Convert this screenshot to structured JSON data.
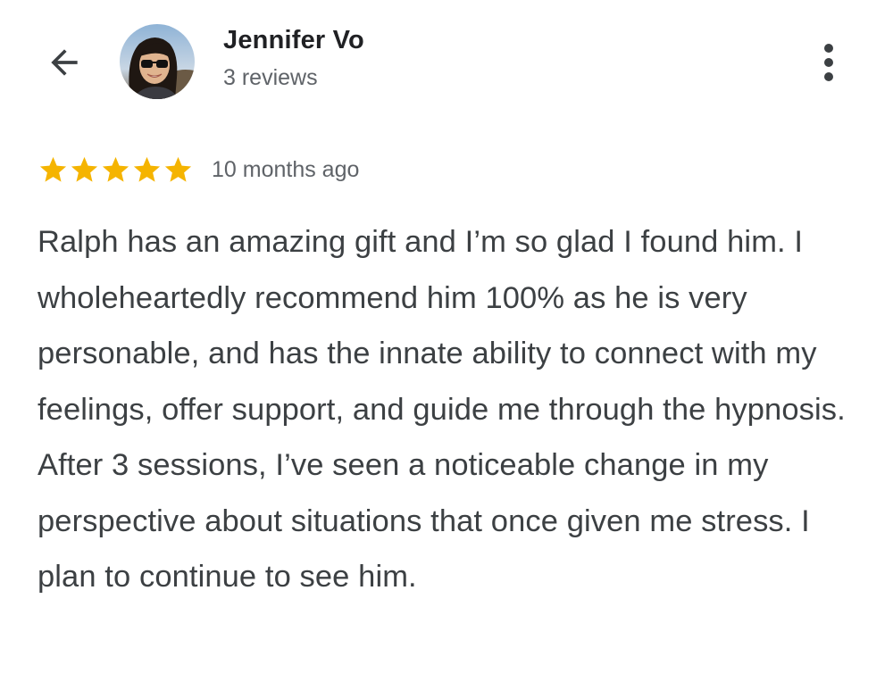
{
  "header": {
    "back_icon": "arrow-left-icon",
    "avatar_icon": "profile-photo",
    "reviewer_name": "Jennifer Vo",
    "review_count": "3 reviews",
    "more_icon": "more-vert-icon"
  },
  "review": {
    "rating": 5,
    "max_rating": 5,
    "star_color": "#f5b400",
    "time_ago": "10 months ago",
    "text": "Ralph has an amazing gift and I’m so glad I found him. I wholeheartedly recommend him 100% as he is very personable, and has the innate ability to connect with my feelings, offer support, and guide me through the hypnosis. After 3 sessions, I’ve seen a noticeable change in my perspective about situations that once given me stress. I plan to continue to see him."
  }
}
